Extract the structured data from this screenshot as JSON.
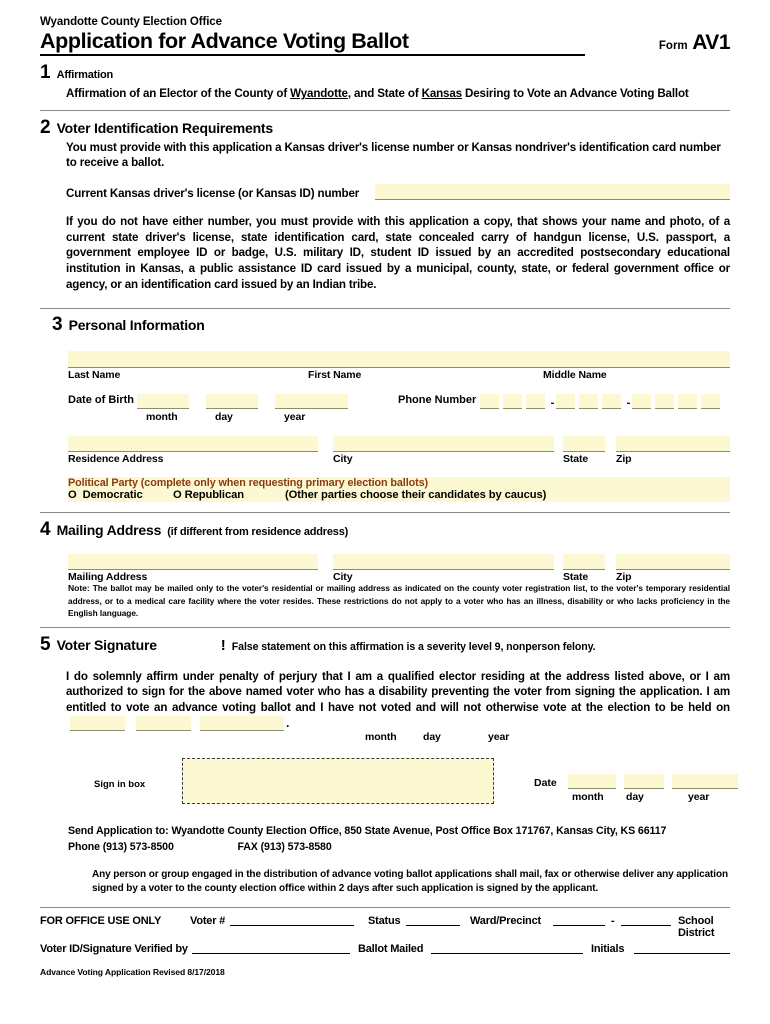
{
  "header": {
    "office": "Wyandotte County Election Office",
    "title": "Application for Advance Voting Ballot",
    "form_prefix": "Form",
    "form_code": "AV1"
  },
  "section1": {
    "number": "1",
    "title": "Affirmation",
    "text_a": "Affirmation of an Elector of the County of ",
    "county": "Wyandotte",
    "text_b": ", and State of ",
    "state": "Kansas",
    "text_c": " Desiring to Vote an Advance Voting Ballot"
  },
  "section2": {
    "number": "2",
    "title": "Voter Identification Requirements",
    "requirement": "You must provide with this application a Kansas driver's license number or Kansas nondriver's identification card number to receive a ballot.",
    "license_label": "Current Kansas driver's license (or Kansas ID) number",
    "license_value": "",
    "alternatives": "If you do not have either number, you must provide with this application a copy, that shows your name and photo, of a current state driver's license, state identification card, state concealed carry of handgun license, U.S. passport, a government employee ID or badge, U.S. military ID, student ID issued by an accredited postsecondary educational institution in Kansas, a public assistance ID card issued by a municipal, county, state, or federal government office or agency, or an identification card issued by an Indian tribe."
  },
  "section3": {
    "number": "3",
    "title": "Personal Information",
    "name_fields": [
      {
        "label": "Last Name",
        "value": ""
      },
      {
        "label": "First Name",
        "value": ""
      },
      {
        "label": "Middle Name",
        "value": ""
      }
    ],
    "dob_label": "Date of Birth",
    "dob_parts": [
      {
        "label": "month",
        "value": ""
      },
      {
        "label": "day",
        "value": ""
      },
      {
        "label": "year",
        "value": ""
      }
    ],
    "phone_label": "Phone Number",
    "phone_groups": [
      3,
      3,
      4
    ],
    "phone_separator": "-",
    "address_fields": [
      {
        "label": "Residence Address",
        "value": ""
      },
      {
        "label": "City",
        "value": ""
      },
      {
        "label": "State",
        "value": ""
      },
      {
        "label": "Zip",
        "value": ""
      }
    ],
    "party_label": "Political Party (complete only when requesting primary election ballots)",
    "party_options": [
      {
        "marker": "O",
        "label": "Democratic"
      },
      {
        "marker": "O",
        "label": "Republican"
      }
    ],
    "party_note": "(Other parties choose their candidates by caucus)",
    "party_label_color": "#8a3a10"
  },
  "section4": {
    "number": "4",
    "title": "Mailing Address",
    "subtitle": "(if different from residence address)",
    "fields": [
      {
        "label": "Mailing Address",
        "value": ""
      },
      {
        "label": "City",
        "value": ""
      },
      {
        "label": "State",
        "value": ""
      },
      {
        "label": "Zip",
        "value": ""
      }
    ],
    "note_label": "Note:",
    "note_text": "The ballot may be mailed only to the voter's residential or mailing address as indicated on the county voter registration list, to the voter's temporary residential address, or to a medical care facility where the voter resides.  These restrictions do not apply to a voter who has an illness, disability or who lacks proficiency in the English language."
  },
  "section5": {
    "number": "5",
    "title": "Voter Signature",
    "warn_icon": "!",
    "warning": "False statement on this affirmation is a severity level 9, nonperson felony.",
    "affirmation": "I do solemnly affirm under penalty of perjury that I am a qualified elector residing at the address listed above, or I am authorized to sign for the above named voter who has a disability preventing the voter from signing the application. I am entitled to vote an advance voting ballot and I have not voted and will not otherwise vote at the election to be held on",
    "election_date_parts": [
      {
        "label": "month",
        "value": ""
      },
      {
        "label": "day",
        "value": ""
      },
      {
        "label": "year",
        "value": ""
      }
    ],
    "period": ".",
    "sign_label": "Sign in box",
    "sign_value": "",
    "date_label": "Date",
    "date_parts": [
      {
        "label": "month",
        "value": ""
      },
      {
        "label": "day",
        "value": ""
      },
      {
        "label": "year",
        "value": ""
      }
    ]
  },
  "footer": {
    "send_to": "Send Application to:  Wyandotte County Election Office, 850 State Avenue, Post Office Box 171767, Kansas City, KS 66117",
    "phone": "Phone (913) 573-8500",
    "fax": "FAX (913) 573-8580",
    "distribution": "Any person or group engaged in the distribution of advance voting ballot applications shall mail, fax or otherwise deliver any application signed by a voter to the county election office within 2 days after such application is signed by the applicant.",
    "revised": "Advance Voting Application Revised 8/17/2018"
  },
  "office_use": {
    "heading": "FOR OFFICE USE ONLY",
    "voter_num_label": "Voter #",
    "status_label": "Status",
    "ward_label": "Ward/Precinct",
    "ward_separator": "-",
    "school_label": "School District",
    "verified_label": "Voter ID/Signature Verified by",
    "ballot_mailed_label": "Ballot Mailed",
    "initials_label": "Initials"
  }
}
